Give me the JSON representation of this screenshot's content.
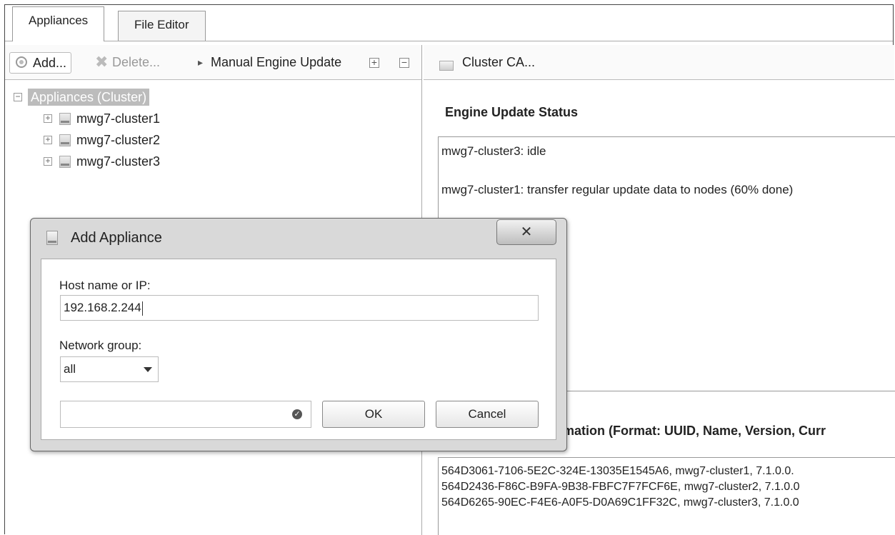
{
  "tabs": [
    {
      "label": "Appliances",
      "active": true
    },
    {
      "label": "File Editor",
      "active": false
    }
  ],
  "toolbar": {
    "add_label": "Add...",
    "delete_label": "Delete...",
    "manual_update_label": "Manual Engine Update",
    "expand_all_glyph": "+",
    "collapse_all_glyph": "−"
  },
  "tree": {
    "root": "Appliances (Cluster)",
    "children": [
      "mwg7-cluster1",
      "mwg7-cluster2",
      "mwg7-cluster3"
    ]
  },
  "right_panel": {
    "header": "Cluster CA...",
    "engine_status_title": "Engine Update Status",
    "status_lines": [
      "mwg7-cluster3: idle",
      "mwg7-cluster1: transfer regular update data to nodes (60% done)"
    ],
    "info_title": "rmation (Format: UUID, Name, Version, Curr",
    "info_lines": [
      "564D3061-7106-5E2C-324E-13035E1545A6, mwg7-cluster1, 7.1.0.0.",
      "564D2436-F86C-B9FA-9B38-FBFC7F7FCF6E, mwg7-cluster2, 7.1.0.0",
      "564D6265-90EC-F4E6-A0F5-D0A69C1FF32C, mwg7-cluster3, 7.1.0.0"
    ]
  },
  "dialog": {
    "title": "Add Appliance",
    "close_glyph": "✕",
    "host_label": "Host name or IP:",
    "host_value": "192.168.2.244",
    "network_label": "Network group:",
    "network_value": "all",
    "ok_label": "OK",
    "cancel_label": "Cancel"
  }
}
